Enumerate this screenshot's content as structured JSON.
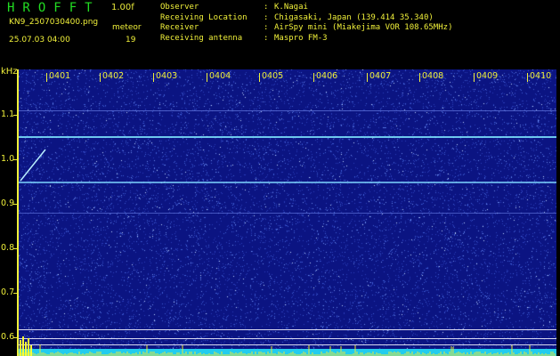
{
  "header": {
    "app_title": "HROFFT",
    "version": "1.00f",
    "filename": "KN9_2507030400.png",
    "meteor_label": "meteor",
    "datetime": "25.07.03 04:00",
    "meteor_count": "19"
  },
  "info": [
    {
      "key": "Observer",
      "value": "K.Nagai"
    },
    {
      "key": "Receiving Location",
      "value": "Chigasaki, Japan (139.414 35.340)"
    },
    {
      "key": "Receiver",
      "value": "AirSpy mini (Miakejima VOR 108.65MHz)"
    },
    {
      "key": "Receiving antenna",
      "value": "Maspro FM-3"
    }
  ],
  "axis": {
    "unit": "kHz",
    "time_labels": [
      "0401",
      "0402",
      "0403",
      "0404",
      "0405",
      "0406",
      "0407",
      "0408",
      "0409",
      "0410"
    ],
    "freq_labels": [
      "1.1",
      "1.0",
      "0.9",
      "0.8",
      "0.7",
      "0.6"
    ]
  },
  "colors": {
    "background": "#000000",
    "spectrogram": "#0b1482",
    "text": "#f0f03a",
    "title": "#22dd22",
    "carrier": "#7fe6ff",
    "baseline": "#22ccee"
  }
}
